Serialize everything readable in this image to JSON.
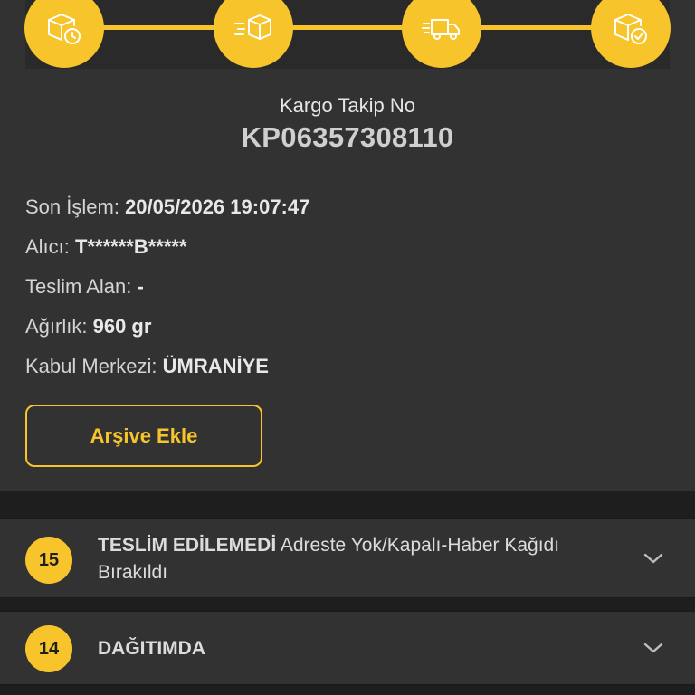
{
  "tracking": {
    "label": "Kargo Takip No",
    "number": "KP06357308110"
  },
  "info": {
    "last_action_label": "Son İşlem:",
    "last_action_value": "20/05/2026 19:07:47",
    "recipient_label": "Alıcı:",
    "recipient_value": "T******B*****",
    "delivered_to_label": "Teslim Alan:",
    "delivered_to_value": "-",
    "weight_label": "Ağırlık:",
    "weight_value": "960 gr",
    "acceptance_center_label": "Kabul Merkezi:",
    "acceptance_center_value": "ÜMRANİYE"
  },
  "archive_button": {
    "label": "Arşive Ekle"
  },
  "progress_steps": [
    {
      "icon": "package-clock-icon"
    },
    {
      "icon": "package-moving-icon"
    },
    {
      "icon": "delivery-truck-icon"
    },
    {
      "icon": "package-check-icon"
    }
  ],
  "history": [
    {
      "badge": "15",
      "status_strong": " TESLİM EDİLEMEDİ",
      "status_rest": " Adreste Yok/Kapalı-Haber Kağıdı Bırakıldı"
    },
    {
      "badge": "14",
      "status_strong": "DAĞITIMDA",
      "status_rest": ""
    }
  ],
  "colors": {
    "accent": "#f7c52b",
    "card_bg": "#323232",
    "page_bg": "#1e1e1e"
  }
}
